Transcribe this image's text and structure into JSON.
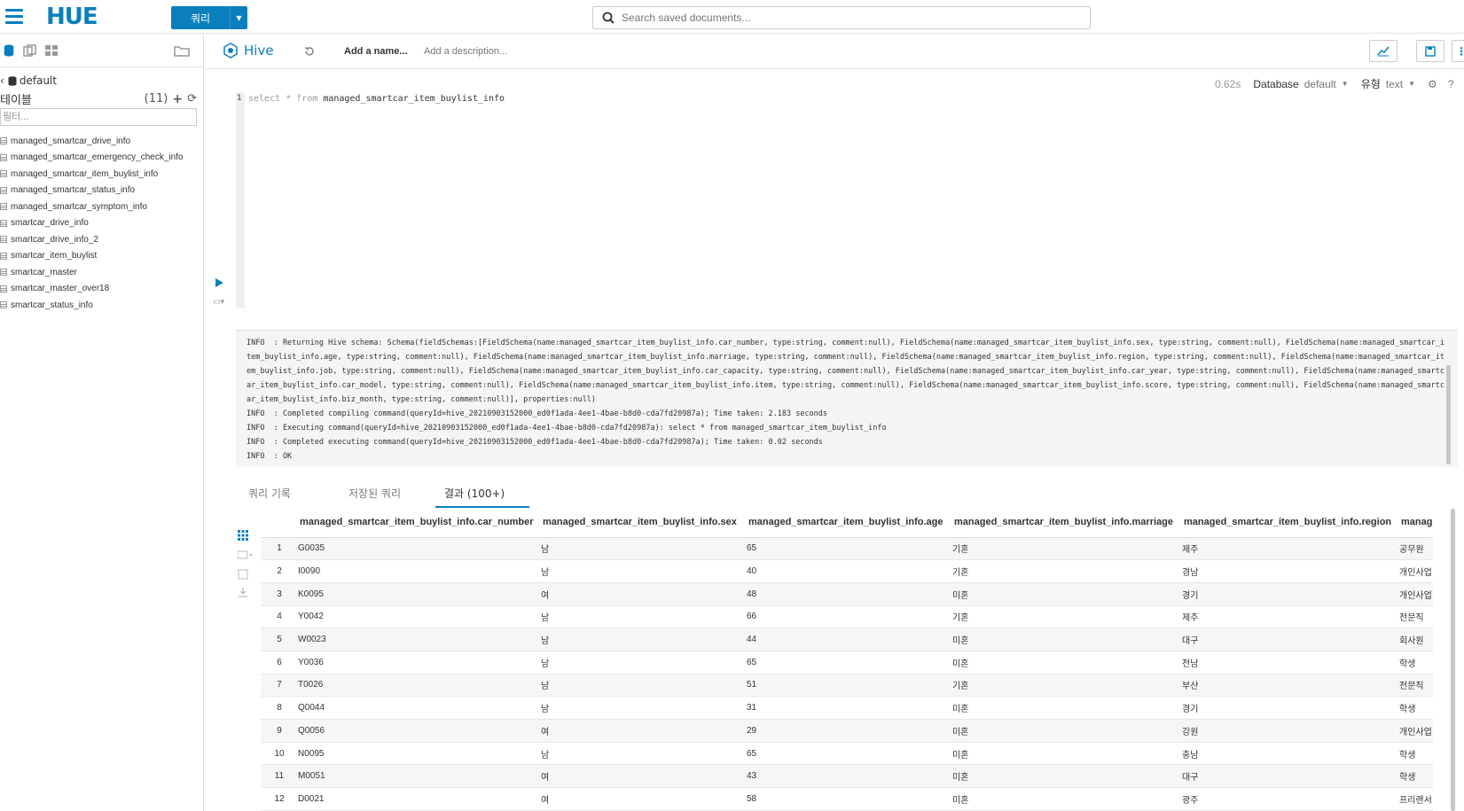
{
  "topbar": {
    "logo": "HUE",
    "query_button": "쿼리",
    "search_placeholder": "Search saved documents..."
  },
  "sidebar": {
    "database": "default",
    "tables_label": "테이블",
    "tables_count": "(11)",
    "filter_placeholder": "필터...",
    "tables": [
      "managed_smartcar_drive_info",
      "managed_smartcar_emergency_check_info",
      "managed_smartcar_item_buylist_info",
      "managed_smartcar_status_info",
      "managed_smartcar_symptom_info",
      "smartcar_drive_info",
      "smartcar_drive_info_2",
      "smartcar_item_buylist",
      "smartcar_master",
      "smartcar_master_over18",
      "smartcar_status_info"
    ]
  },
  "editor": {
    "engine": "Hive",
    "add_name": "Add a name...",
    "add_description": "Add a description...",
    "time": "0.62s",
    "database_label": "Database",
    "database_value": "default",
    "type_label": "유형",
    "type_value": "text",
    "line_number": "1",
    "query_keyword1": "select * from",
    "query_table": "managed_smartcar_item_buylist_info"
  },
  "log": "INFO  : Returning Hive schema: Schema(fieldSchemas:[FieldSchema(name:managed_smartcar_item_buylist_info.car_number, type:string, comment:null), FieldSchema(name:managed_smartcar_item_buylist_info.sex, type:string, comment:null), FieldSchema(name:managed_smartcar_item_buylist_info.age, type:string, comment:null), FieldSchema(name:managed_smartcar_item_buylist_info.marriage, type:string, comment:null), FieldSchema(name:managed_smartcar_item_buylist_info.region, type:string, comment:null), FieldSchema(name:managed_smartcar_item_buylist_info.job, type:string, comment:null), FieldSchema(name:managed_smartcar_item_buylist_info.car_capacity, type:string, comment:null), FieldSchema(name:managed_smartcar_item_buylist_info.car_year, type:string, comment:null), FieldSchema(name:managed_smartcar_item_buylist_info.car_model, type:string, comment:null), FieldSchema(name:managed_smartcar_item_buylist_info.item, type:string, comment:null), FieldSchema(name:managed_smartcar_item_buylist_info.score, type:string, comment:null), FieldSchema(name:managed_smartcar_item_buylist_info.biz_month, type:string, comment:null)], properties:null)\nINFO  : Completed compiling command(queryId=hive_20210903152000_ed0f1ada-4ee1-4bae-b8d0-cda7fd20987a); Time taken: 2.183 seconds\nINFO  : Executing command(queryId=hive_20210903152000_ed0f1ada-4ee1-4bae-b8d0-cda7fd20987a): select * from managed_smartcar_item_buylist_info\nINFO  : Completed executing command(queryId=hive_20210903152000_ed0f1ada-4ee1-4bae-b8d0-cda7fd20987a); Time taken: 0.02 seconds\nINFO  : OK",
  "tabs": [
    "쿼리 기록",
    "저장된 쿼리",
    "결과 (100+)"
  ],
  "results": {
    "columns": [
      "managed_smartcar_item_buylist_info.car_number",
      "managed_smartcar_item_buylist_info.sex",
      "managed_smartcar_item_buylist_info.age",
      "managed_smartcar_item_buylist_info.marriage",
      "managed_smartcar_item_buylist_info.region",
      "managed_smartcar_item_buylist_info.job"
    ],
    "rows": [
      [
        "1",
        "G0035",
        "남",
        "65",
        "기혼",
        "제주",
        "공무원"
      ],
      [
        "2",
        "I0090",
        "남",
        "40",
        "기혼",
        "경남",
        "개인사업"
      ],
      [
        "3",
        "K0095",
        "여",
        "48",
        "미혼",
        "경기",
        "개인사업"
      ],
      [
        "4",
        "Y0042",
        "남",
        "66",
        "기혼",
        "제주",
        "전문직"
      ],
      [
        "5",
        "W0023",
        "남",
        "44",
        "미혼",
        "대구",
        "회사원"
      ],
      [
        "6",
        "Y0036",
        "남",
        "65",
        "미혼",
        "전남",
        "학생"
      ],
      [
        "7",
        "T0026",
        "남",
        "51",
        "기혼",
        "부산",
        "전문직"
      ],
      [
        "8",
        "Q0044",
        "남",
        "31",
        "미혼",
        "경기",
        "학생"
      ],
      [
        "9",
        "Q0056",
        "여",
        "29",
        "미혼",
        "강원",
        "개인사업"
      ],
      [
        "10",
        "N0095",
        "남",
        "65",
        "미혼",
        "충남",
        "학생"
      ],
      [
        "11",
        "M0051",
        "여",
        "43",
        "미혼",
        "대구",
        "학생"
      ],
      [
        "12",
        "D0021",
        "여",
        "58",
        "미혼",
        "광주",
        "프리랜서"
      ]
    ]
  }
}
